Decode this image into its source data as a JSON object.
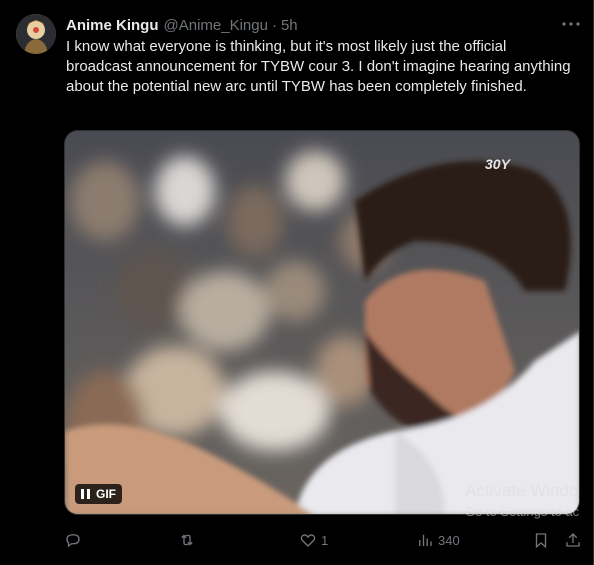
{
  "tweet": {
    "author_name": "Anime Kingu",
    "author_handle": "@Anime_Kingu",
    "separator": "·",
    "time": "5h",
    "text": "I know what everyone is thinking, but it's most likely just the official broadcast announcement for TYBW cour 3. I don't imagine hearing anything about the potential new arc until TYBW has been completely finished."
  },
  "media": {
    "type_badge": "GIF",
    "corner_logo": "30Y"
  },
  "actions": {
    "reply_count": "",
    "retweet_count": "",
    "like_count": "1",
    "views_count": "340"
  },
  "os_watermark": {
    "title": "Activate Windo",
    "subtitle": "Go to Settings to ac"
  },
  "icons": [
    "more-icon",
    "pause-icon",
    "reply-icon",
    "retweet-icon",
    "like-icon",
    "views-icon",
    "bookmark-icon",
    "share-icon"
  ]
}
